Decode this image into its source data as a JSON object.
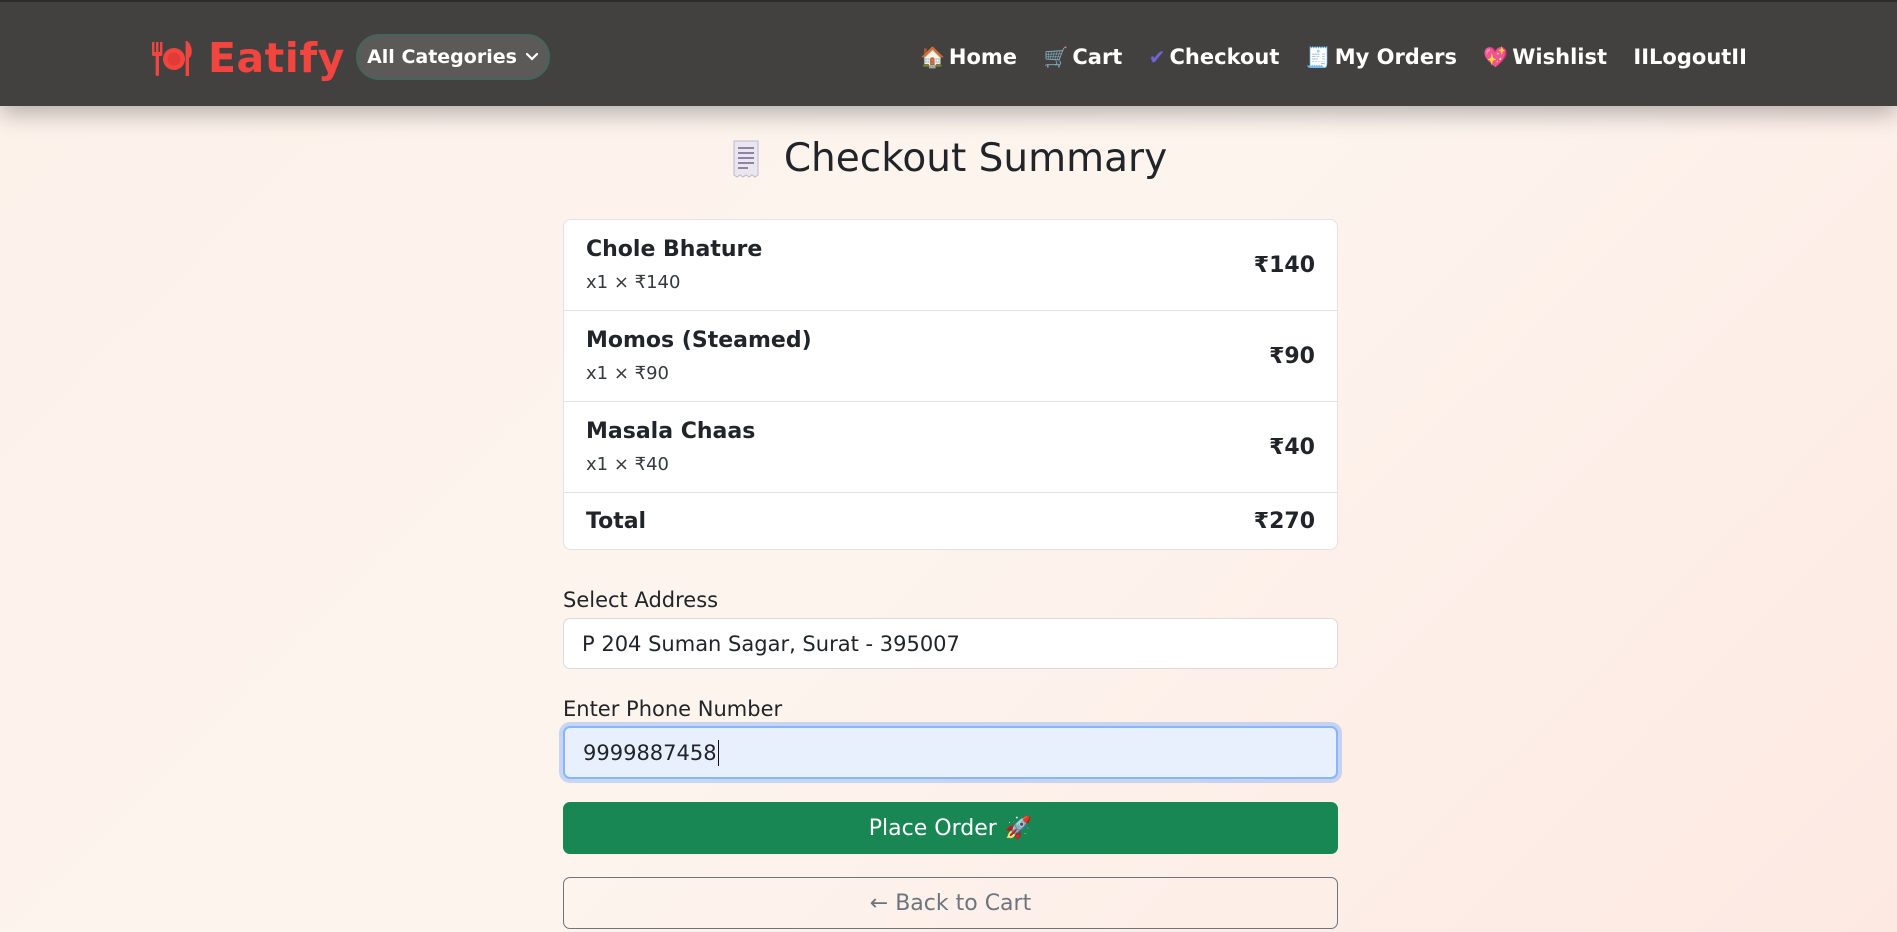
{
  "navbar": {
    "brand": "Eatify",
    "categories_label": "All Categories",
    "links": [
      {
        "icon": "house-emoji",
        "emoji": "🏠",
        "label": "Home"
      },
      {
        "icon": "cart-emoji",
        "emoji": "🛒",
        "label": "Cart"
      },
      {
        "icon": "check-emoji",
        "emoji": "✔",
        "label": "Checkout"
      },
      {
        "icon": "receipt-emoji",
        "emoji": "🧾",
        "label": "My Orders"
      },
      {
        "icon": "heart-emoji",
        "emoji": "💖",
        "label": "Wishlist"
      },
      {
        "icon": "",
        "emoji": "",
        "label": "IILogoutII"
      }
    ]
  },
  "page": {
    "title": "Checkout Summary"
  },
  "summary": {
    "items": [
      {
        "name": "Chole Bhature",
        "qty": "x1 × ₹140",
        "price": "₹140"
      },
      {
        "name": "Momos (Steamed)",
        "qty": "x1 × ₹90",
        "price": "₹90"
      },
      {
        "name": "Masala Chaas",
        "qty": "x1 × ₹40",
        "price": "₹40"
      }
    ],
    "total_label": "Total",
    "total_value": "₹270"
  },
  "form": {
    "address_label": "Select Address",
    "address_value": "P 204 Suman Sagar, Surat - 395007",
    "phone_label": "Enter Phone Number",
    "phone_value": "9999887458"
  },
  "buttons": {
    "place_order": "Place Order",
    "place_order_emoji": "🚀",
    "back_to_cart": "← Back to Cart"
  },
  "colors": {
    "brand": "#f2453f",
    "navbar_bg": "#434140",
    "place_order_bg": "#198754"
  }
}
